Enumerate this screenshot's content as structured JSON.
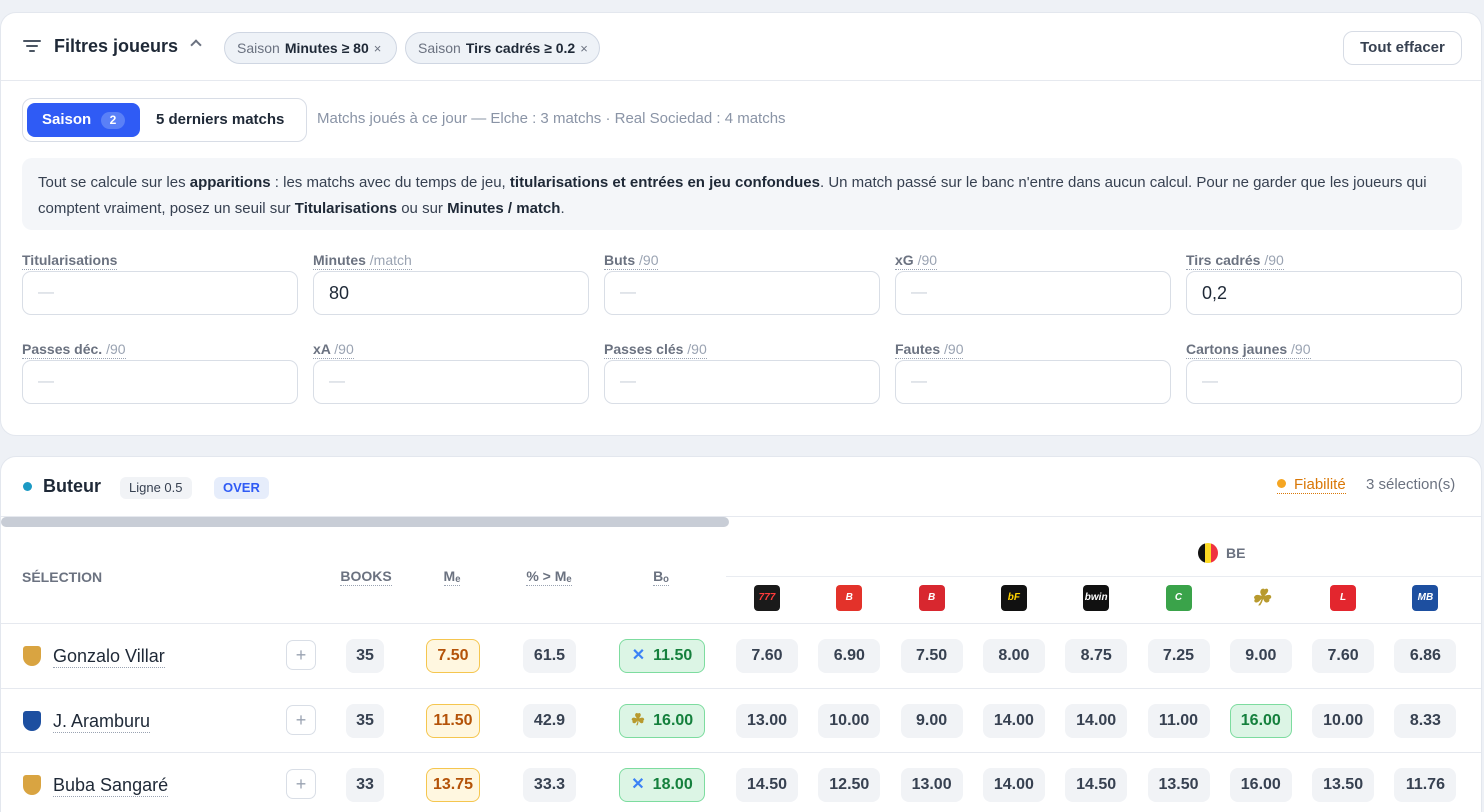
{
  "filters": {
    "title": "Filtres joueurs",
    "chips": [
      {
        "scope": "Saison",
        "label": "Minutes ≥ 80",
        "x": "×"
      },
      {
        "scope": "Saison",
        "label": "Tirs cadrés ≥ 0.2",
        "x": "×"
      }
    ],
    "clear_label": "Tout effacer",
    "seg_active": "Saison",
    "seg_badge": "2",
    "seg_other": "5 derniers matchs",
    "matches_played": "Matchs joués à ce jour — Elche : 3 matchs · Real Sociedad : 4 matchs",
    "info": {
      "p1": "Tout se calcule sur les ",
      "b1": "apparitions",
      "p2": " : les matchs avec du temps de jeu, ",
      "b2": "titularisations et entrées en jeu confondues",
      "p3": ". Un match passé sur le banc n'entre dans aucun calcul. Pour ne garder que les joueurs qui comptent vraiment, posez un seuil sur ",
      "b3": "Titularisations",
      "p4": " ou sur ",
      "b4": "Minutes / match",
      "p5": "."
    },
    "fields": [
      {
        "label": "Titularisations",
        "unit": "",
        "value": "—",
        "empty": true
      },
      {
        "label": "Minutes",
        "unit": "/match",
        "value": "80",
        "empty": false
      },
      {
        "label": "Buts",
        "unit": "/90",
        "value": "—",
        "empty": true
      },
      {
        "label": "xG",
        "unit": "/90",
        "value": "—",
        "empty": true
      },
      {
        "label": "Tirs cadrés",
        "unit": "/90",
        "value": "0,2",
        "empty": false
      },
      {
        "label": "Passes déc.",
        "unit": "/90",
        "value": "—",
        "empty": true
      },
      {
        "label": "xA",
        "unit": "/90",
        "value": "—",
        "empty": true
      },
      {
        "label": "Passes clés",
        "unit": "/90",
        "value": "—",
        "empty": true
      },
      {
        "label": "Fautes",
        "unit": "/90",
        "value": "—",
        "empty": true
      },
      {
        "label": "Cartons jaunes",
        "unit": "/90",
        "value": "—",
        "empty": true
      }
    ]
  },
  "market": {
    "title": "Buteur",
    "line": "Ligne 0.5",
    "side": "OVER",
    "reliability": "Fiabilité",
    "selections": "3 sélection(s)",
    "headers": {
      "selection": "SÉLECTION",
      "books": "BOOKS",
      "median": "Mₑ",
      "pct": "% > Mₑ",
      "best": "Bₒ"
    },
    "region": "BE",
    "bookmakers": [
      {
        "name": "777.be",
        "short": "777",
        "color": "#1a1a1a",
        "fg": "#ff3b3b"
      },
      {
        "name": "Betano",
        "short": "B",
        "color": "#e3322a",
        "fg": "#ffffff"
      },
      {
        "name": "Betfirst",
        "short": "B",
        "color": "#d8272f",
        "fg": "#ffffff"
      },
      {
        "name": "bF",
        "short": "bF",
        "color": "#111111",
        "fg": "#ffd400"
      },
      {
        "name": "bwin",
        "short": "bwin",
        "color": "#111111",
        "fg": "#ffffff"
      },
      {
        "name": "Circus",
        "short": "C",
        "color": "#3aa34a",
        "fg": "#ffffff"
      },
      {
        "name": "Golden Palace",
        "short": "☘",
        "color": "#ffffff",
        "fg": "#b89a2e"
      },
      {
        "name": "Ladbrokes",
        "short": "L",
        "color": "#e3262e",
        "fg": "#ffffff"
      },
      {
        "name": "MB",
        "short": "MB",
        "color": "#1d4fa0",
        "fg": "#ffffff"
      }
    ],
    "rows": [
      {
        "name": "Gonzalo Villar",
        "crest": "#d9a441",
        "books": "35",
        "median": "7.50",
        "pct": "61.5",
        "best": "11.50",
        "best_icon": "✕",
        "odds": [
          "7.60",
          "6.90",
          "7.50",
          "8.00",
          "8.75",
          "7.25",
          "9.00",
          "7.60",
          "6.86"
        ],
        "hi": -1
      },
      {
        "name": "J. Aramburu",
        "crest": "#1d4fa0",
        "books": "35",
        "median": "11.50",
        "pct": "42.9",
        "best": "16.00",
        "best_icon": "☘",
        "odds": [
          "13.00",
          "10.00",
          "9.00",
          "14.00",
          "14.00",
          "11.00",
          "16.00",
          "10.00",
          "8.33"
        ],
        "hi": 6
      },
      {
        "name": "Buba Sangaré",
        "crest": "#d9a441",
        "books": "33",
        "median": "13.75",
        "pct": "33.3",
        "best": "18.00",
        "best_icon": "✕",
        "odds": [
          "14.50",
          "12.50",
          "13.00",
          "14.00",
          "14.50",
          "13.50",
          "16.00",
          "13.50",
          "11.76"
        ],
        "hi": -1
      }
    ],
    "accent_colors": {
      "over": "#2f5bf5",
      "median": "#b45309",
      "best": "#15803d"
    }
  }
}
